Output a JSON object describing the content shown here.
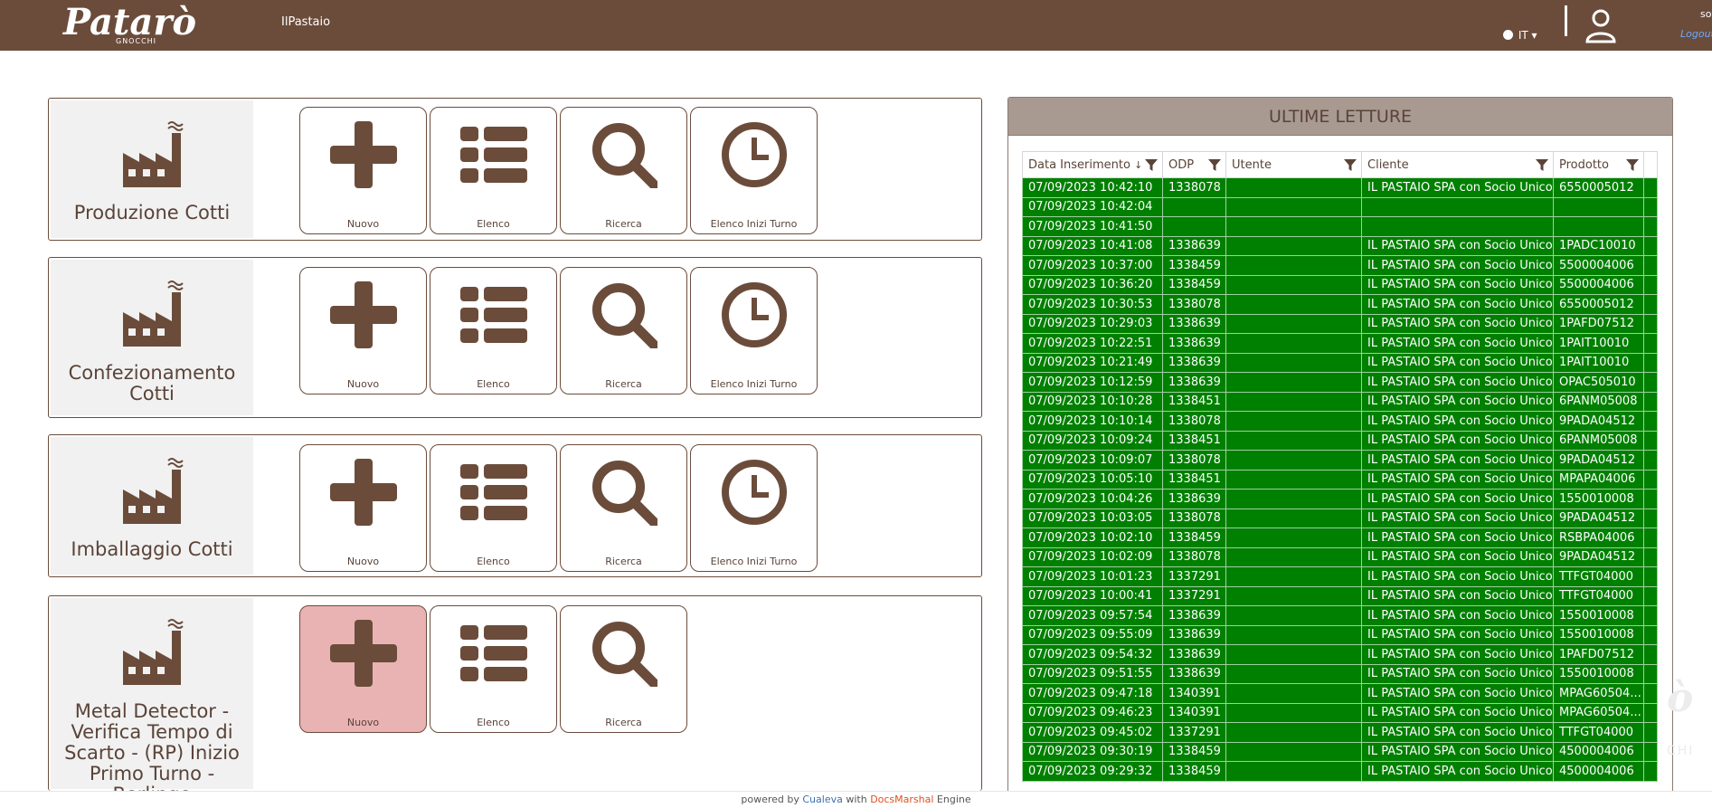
{
  "header": {
    "logo_text": "Patarò",
    "logo_sub": "GNOCCHI",
    "app_name": "IlPastaio",
    "language": "IT",
    "user_name": "so",
    "logout_label": "Logout"
  },
  "cards": [
    {
      "title": "Produzione Cotti",
      "buttons": [
        "Nuovo",
        "Elenco",
        "Ricerca",
        "Elenco Inizi Turno"
      ]
    },
    {
      "title": "Confezionamento Cotti",
      "buttons": [
        "Nuovo",
        "Elenco",
        "Ricerca",
        "Elenco Inizi Turno"
      ]
    },
    {
      "title": "Imballaggio Cotti",
      "buttons": [
        "Nuovo",
        "Elenco",
        "Ricerca",
        "Elenco Inizi Turno"
      ]
    },
    {
      "title": "Metal Detector - Verifica Tempo di Scarto - (RP) Inizio Primo Turno - Berlingo",
      "buttons": [
        "Nuovo",
        "Elenco",
        "Ricerca"
      ]
    }
  ],
  "panel": {
    "title": "ULTIME LETTURE",
    "columns": [
      "Data Inserimento",
      "ODP",
      "Utente",
      "Cliente",
      "Prodotto"
    ],
    "rows": [
      [
        "07/09/2023 10:42:10",
        "1338078",
        "",
        "IL PASTAIO SPA con Socio Unico",
        "6550005012"
      ],
      [
        "07/09/2023 10:42:04",
        "",
        "",
        "",
        ""
      ],
      [
        "07/09/2023 10:41:50",
        "",
        "",
        "",
        ""
      ],
      [
        "07/09/2023 10:41:08",
        "1338639",
        "",
        "IL PASTAIO SPA con Socio Unico",
        "1PADC10010"
      ],
      [
        "07/09/2023 10:37:00",
        "1338459",
        "",
        "IL PASTAIO SPA con Socio Unico",
        "5500004006"
      ],
      [
        "07/09/2023 10:36:20",
        "1338459",
        "",
        "IL PASTAIO SPA con Socio Unico",
        "5500004006"
      ],
      [
        "07/09/2023 10:30:53",
        "1338078",
        "",
        "IL PASTAIO SPA con Socio Unico",
        "6550005012"
      ],
      [
        "07/09/2023 10:29:03",
        "1338639",
        "",
        "IL PASTAIO SPA con Socio Unico",
        "1PAFD07512"
      ],
      [
        "07/09/2023 10:22:51",
        "1338639",
        "",
        "IL PASTAIO SPA con Socio Unico",
        "1PAIT10010"
      ],
      [
        "07/09/2023 10:21:49",
        "1338639",
        "",
        "IL PASTAIO SPA con Socio Unico",
        "1PAIT10010"
      ],
      [
        "07/09/2023 10:12:59",
        "1338639",
        "",
        "IL PASTAIO SPA con Socio Unico",
        "OPAC505010"
      ],
      [
        "07/09/2023 10:10:28",
        "1338451",
        "",
        "IL PASTAIO SPA con Socio Unico",
        "6PANM05008"
      ],
      [
        "07/09/2023 10:10:14",
        "1338078",
        "",
        "IL PASTAIO SPA con Socio Unico",
        "9PADA04512"
      ],
      [
        "07/09/2023 10:09:24",
        "1338451",
        "",
        "IL PASTAIO SPA con Socio Unico",
        "6PANM05008"
      ],
      [
        "07/09/2023 10:09:07",
        "1338078",
        "",
        "IL PASTAIO SPA con Socio Unico",
        "9PADA04512"
      ],
      [
        "07/09/2023 10:05:10",
        "1338451",
        "",
        "IL PASTAIO SPA con Socio Unico",
        "MPAPA04006"
      ],
      [
        "07/09/2023 10:04:26",
        "1338639",
        "",
        "IL PASTAIO SPA con Socio Unico",
        "1550010008"
      ],
      [
        "07/09/2023 10:03:05",
        "1338078",
        "",
        "IL PASTAIO SPA con Socio Unico",
        "9PADA04512"
      ],
      [
        "07/09/2023 10:02:10",
        "1338459",
        "",
        "IL PASTAIO SPA con Socio Unico",
        "RSBPA04006"
      ],
      [
        "07/09/2023 10:02:09",
        "1338078",
        "",
        "IL PASTAIO SPA con Socio Unico",
        "9PADA04512"
      ],
      [
        "07/09/2023 10:01:23",
        "1337291",
        "",
        "IL PASTAIO SPA con Socio Unico",
        "TTFGT04000"
      ],
      [
        "07/09/2023 10:00:41",
        "1337291",
        "",
        "IL PASTAIO SPA con Socio Unico",
        "TTFGT04000"
      ],
      [
        "07/09/2023 09:57:54",
        "1338639",
        "",
        "IL PASTAIO SPA con Socio Unico",
        "1550010008"
      ],
      [
        "07/09/2023 09:55:09",
        "1338639",
        "",
        "IL PASTAIO SPA con Socio Unico",
        "1550010008"
      ],
      [
        "07/09/2023 09:54:32",
        "1338639",
        "",
        "IL PASTAIO SPA con Socio Unico",
        "1PAFD07512"
      ],
      [
        "07/09/2023 09:51:55",
        "1338639",
        "",
        "IL PASTAIO SPA con Socio Unico",
        "1550010008"
      ],
      [
        "07/09/2023 09:47:18",
        "1340391",
        "",
        "IL PASTAIO SPA con Socio Unico",
        "MPAG60504..."
      ],
      [
        "07/09/2023 09:46:23",
        "1340391",
        "",
        "IL PASTAIO SPA con Socio Unico",
        "MPAG60504..."
      ],
      [
        "07/09/2023 09:45:02",
        "1337291",
        "",
        "IL PASTAIO SPA con Socio Unico",
        "TTFGT04000"
      ],
      [
        "07/09/2023 09:30:19",
        "1338459",
        "",
        "IL PASTAIO SPA con Socio Unico",
        "4500004006"
      ],
      [
        "07/09/2023 09:29:32",
        "1338459",
        "",
        "IL PASTAIO SPA con Socio Unico",
        "4500004006"
      ]
    ]
  },
  "watermark": {
    "text": "ò",
    "sub": "CHI"
  },
  "footer": {
    "prefix": "powered by ",
    "brand1": "Cualeva",
    "mid": " with ",
    "brand2": "DocsMarshal",
    "suffix": " Engine"
  },
  "colors": {
    "brand": "#6b4c3b",
    "row_green": "#008000",
    "active_button": "#e9b3b3"
  }
}
